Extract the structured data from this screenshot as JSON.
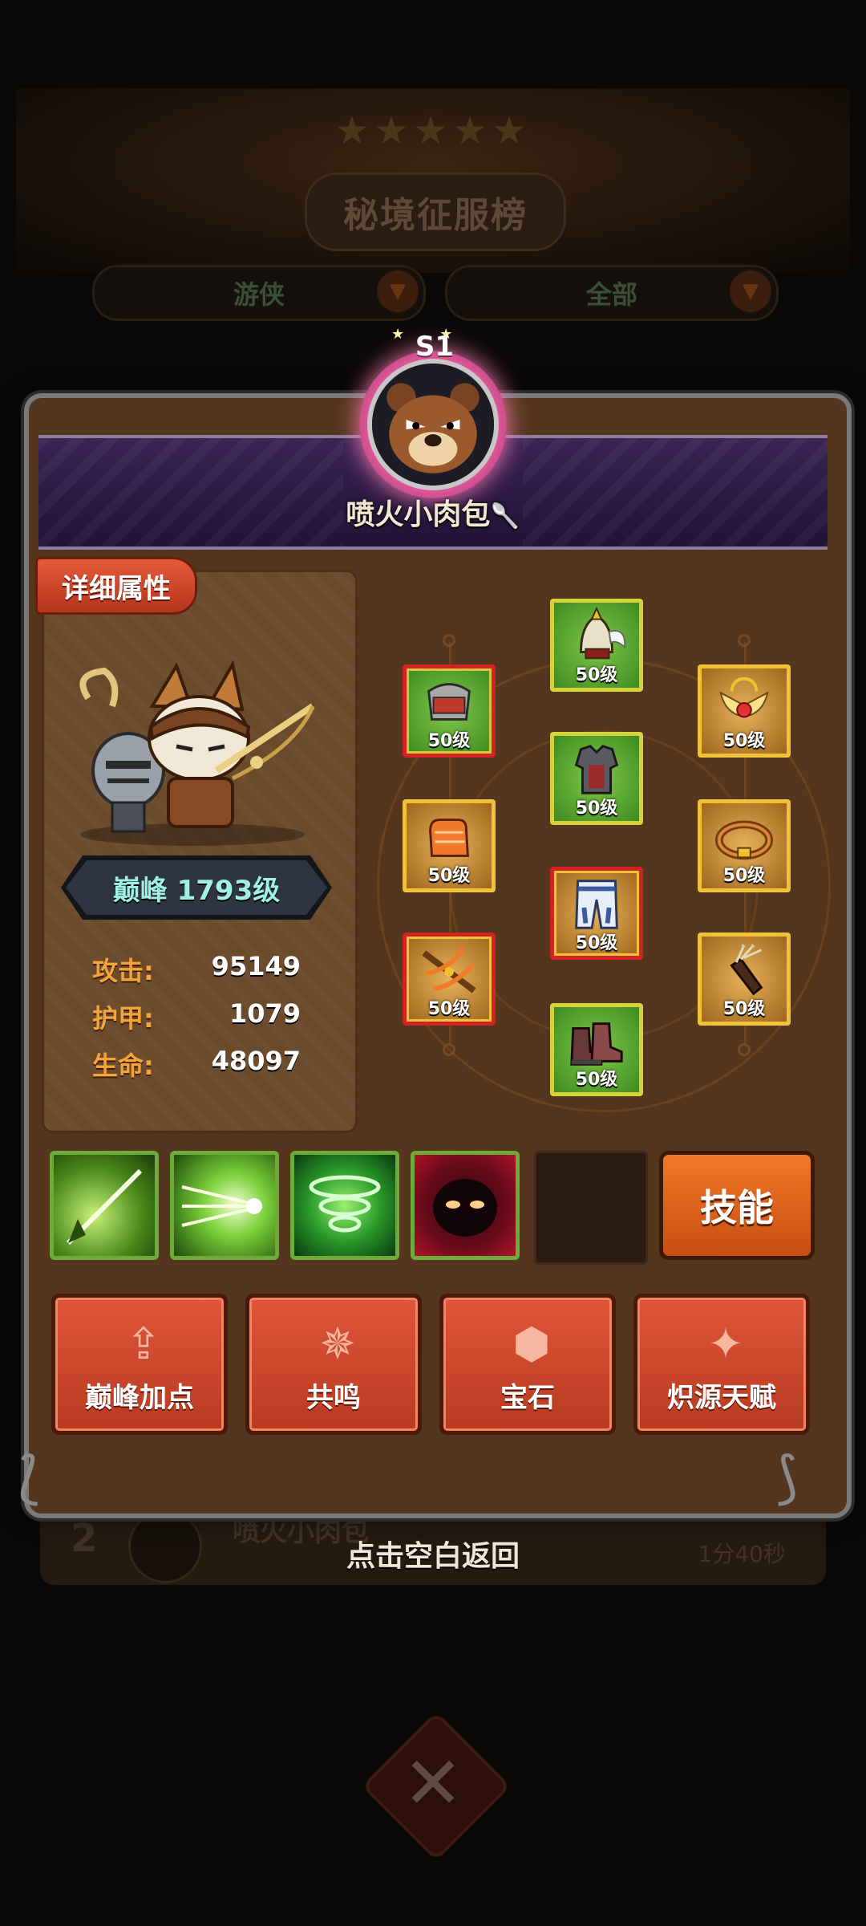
{
  "background": {
    "title": "秘境征服榜",
    "class_filter": "游侠",
    "range_filter": "全部",
    "rank_badges": [
      "S1",
      "S1"
    ],
    "row": {
      "rank": "2",
      "name": "喷火小肉包",
      "time": "1分40秒"
    }
  },
  "profile": {
    "season": "S1",
    "player_name": "喷火小肉包",
    "name_suffix_icon": "torch-icon"
  },
  "attributes": {
    "tab_label": "详细属性",
    "level_text": "巅峰 1793级",
    "stats": [
      {
        "label": "攻击:",
        "value": "95149"
      },
      {
        "label": "护甲:",
        "value": "1079"
      },
      {
        "label": "生命:",
        "value": "48097"
      }
    ]
  },
  "equipment": [
    {
      "slot": "helmet",
      "level": "50级",
      "rarity": "green"
    },
    {
      "slot": "shoulder",
      "level": "50级",
      "rarity": "green-red"
    },
    {
      "slot": "amulet",
      "level": "50级",
      "rarity": "orange"
    },
    {
      "slot": "chest",
      "level": "50级",
      "rarity": "green"
    },
    {
      "slot": "gloves",
      "level": "50级",
      "rarity": "orange"
    },
    {
      "slot": "ring",
      "level": "50级",
      "rarity": "orange"
    },
    {
      "slot": "pants",
      "level": "50级",
      "rarity": "orange-red"
    },
    {
      "slot": "weapon",
      "level": "50级",
      "rarity": "orange-red"
    },
    {
      "slot": "quiver",
      "level": "50级",
      "rarity": "orange"
    },
    {
      "slot": "boots",
      "level": "50级",
      "rarity": "green"
    }
  ],
  "skills": {
    "button_label": "技能",
    "icons": [
      "arrow-strike-icon",
      "multi-shot-icon",
      "whirlwind-icon",
      "shadow-demon-icon"
    ]
  },
  "functions": [
    {
      "label": "巅峰加点",
      "icon": "arrow-up-plus-icon"
    },
    {
      "label": "共鸣",
      "icon": "star-burst-icon"
    },
    {
      "label": "宝石",
      "icon": "gem-ring-icon"
    },
    {
      "label": "炽源天赋",
      "icon": "diamond-star-icon"
    }
  ],
  "footer": {
    "hint": "点击空白返回"
  },
  "colors": {
    "panel_bg": "#53361d",
    "accent_orange": "#f07a28",
    "button_red": "#c84a2c",
    "level_text": "#9ff0e6",
    "stat_label": "#f5a43a"
  }
}
